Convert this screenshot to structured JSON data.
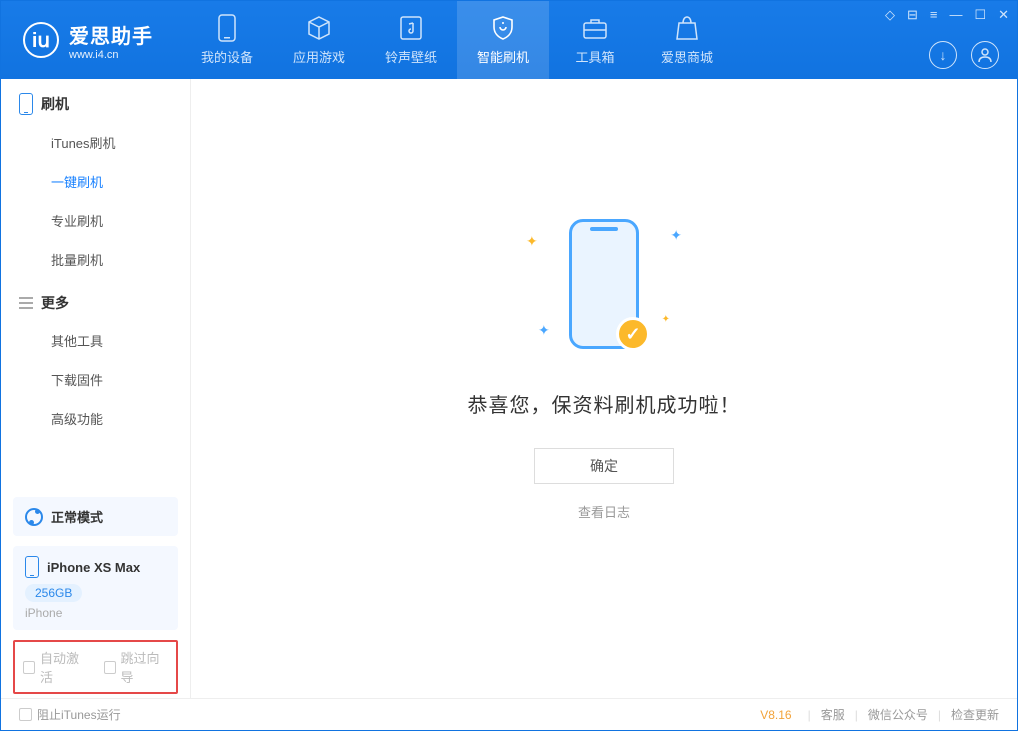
{
  "app": {
    "title": "爱思助手",
    "subtitle": "www.i4.cn"
  },
  "titlebar": {
    "c1": "◇",
    "c2": "⊟",
    "c3": "≡",
    "min": "—",
    "max": "☐",
    "close": "✕"
  },
  "tabs": [
    {
      "label": "我的设备"
    },
    {
      "label": "应用游戏"
    },
    {
      "label": "铃声壁纸"
    },
    {
      "label": "智能刷机",
      "active": true
    },
    {
      "label": "工具箱"
    },
    {
      "label": "爱思商城"
    }
  ],
  "sidebar": {
    "section1": {
      "title": "刷机",
      "items": [
        "iTunes刷机",
        "一键刷机",
        "专业刷机",
        "批量刷机"
      ],
      "active_index": 1
    },
    "section2": {
      "title": "更多",
      "items": [
        "其他工具",
        "下载固件",
        "高级功能"
      ]
    },
    "mode": "正常模式",
    "device": {
      "name": "iPhone XS Max",
      "storage": "256GB",
      "type": "iPhone"
    },
    "checks": {
      "auto_activate": "自动激活",
      "skip_guide": "跳过向导"
    }
  },
  "main": {
    "success": "恭喜您，保资料刷机成功啦！",
    "ok": "确定",
    "view_log": "查看日志"
  },
  "footer": {
    "block_itunes": "阻止iTunes运行",
    "version": "V8.16",
    "links": [
      "客服",
      "微信公众号",
      "检查更新"
    ]
  }
}
